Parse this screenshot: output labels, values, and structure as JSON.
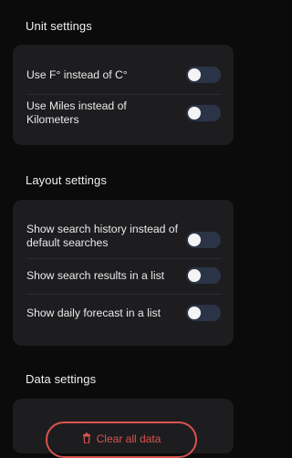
{
  "unit_settings": {
    "title": "Unit settings",
    "rows": [
      {
        "label": "Use F° instead of C°",
        "enabled": false
      },
      {
        "label": "Use Miles instead of Kilometers",
        "enabled": false
      }
    ]
  },
  "layout_settings": {
    "title": "Layout settings",
    "rows": [
      {
        "label": "Show search history instead of default searches",
        "enabled": false
      },
      {
        "label": "Show search results in a list",
        "enabled": false
      },
      {
        "label": "Show daily forecast in a list",
        "enabled": false
      }
    ]
  },
  "data_settings": {
    "title": "Data settings",
    "button_label": "Clear all data"
  },
  "colors": {
    "background": "#0b0b0b",
    "card": "#1d1d20",
    "toggle_track": "#2b3447",
    "toggle_knob": "#f4f4f4",
    "danger": "#d9534f"
  }
}
